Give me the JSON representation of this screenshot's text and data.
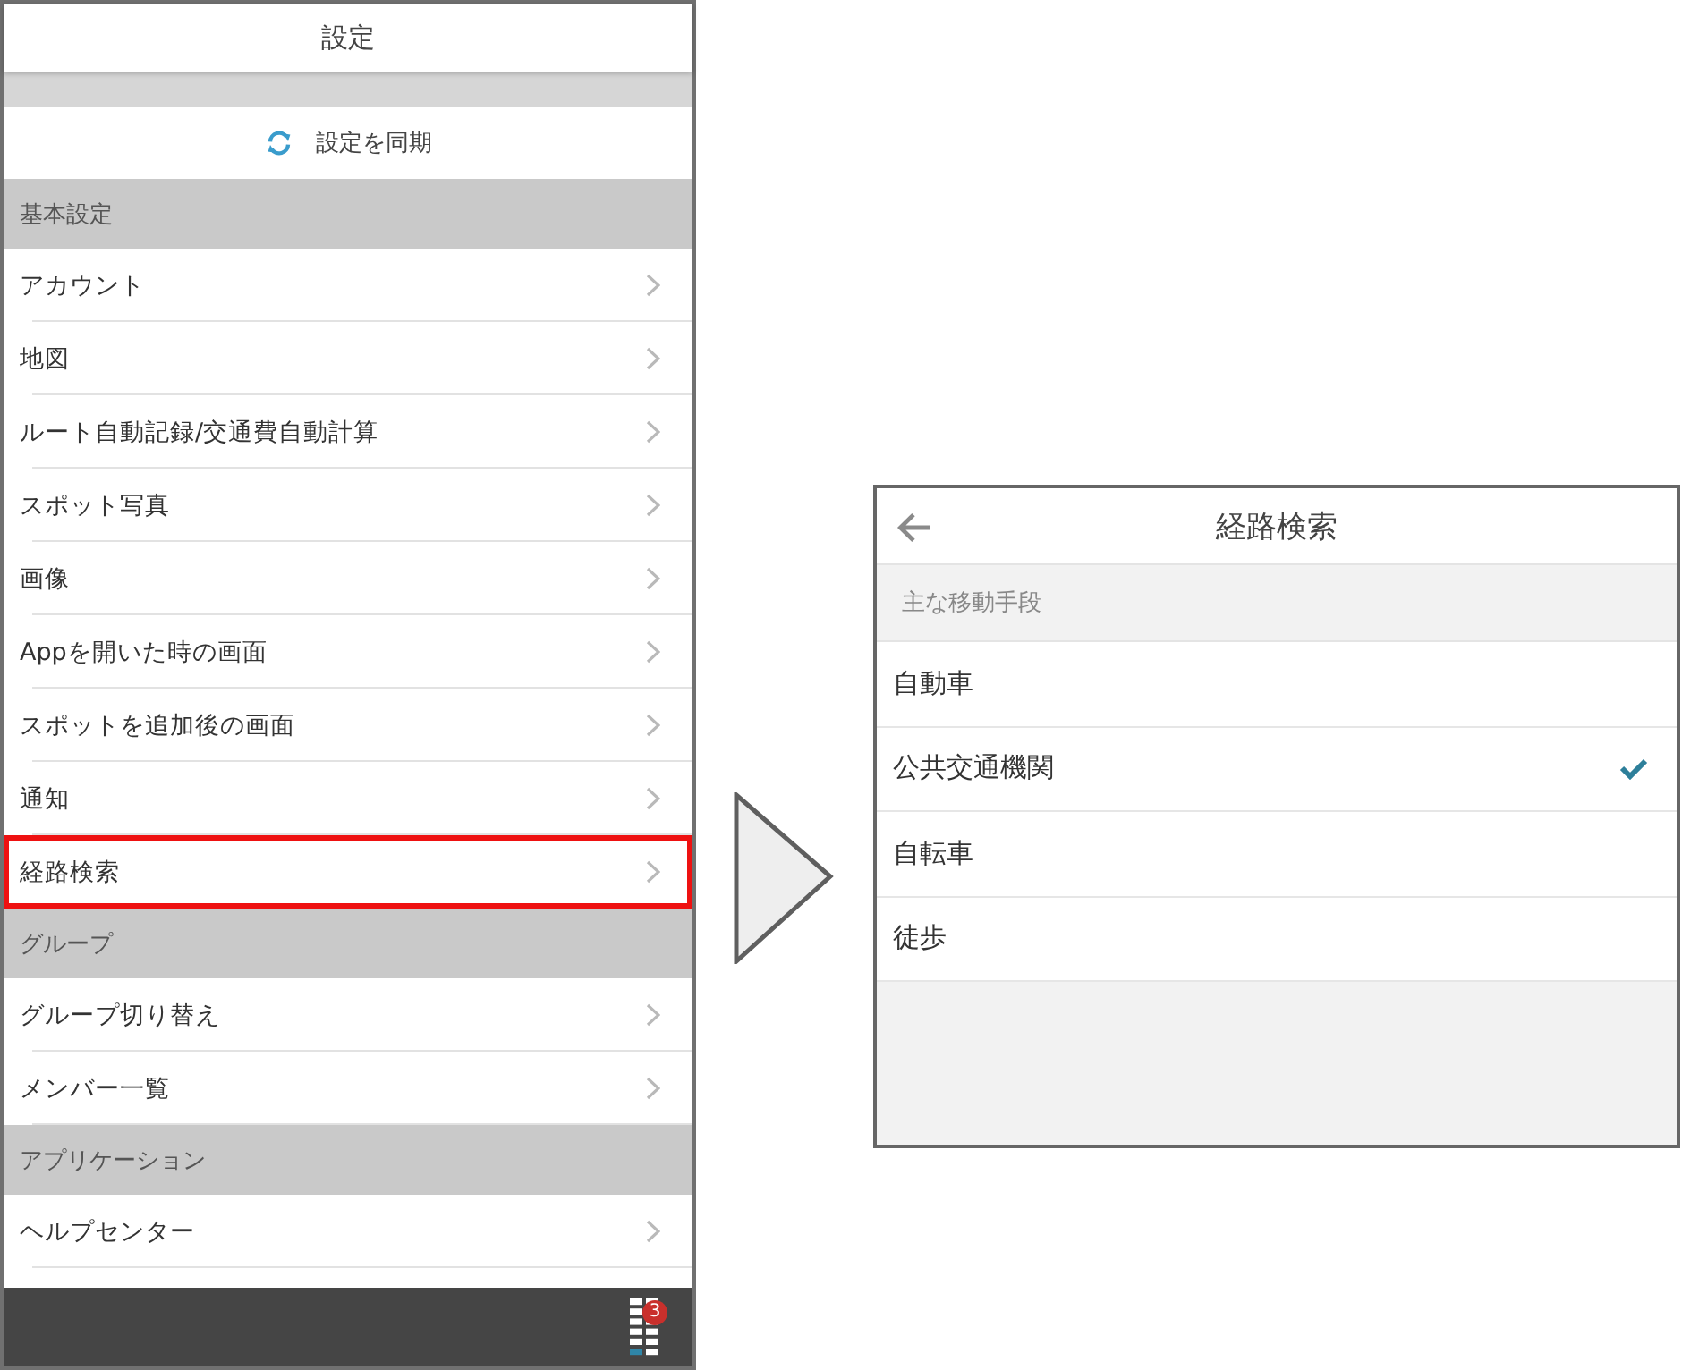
{
  "left_screen": {
    "title": "設定",
    "sync_button": "設定を同期",
    "sections": [
      {
        "header": "基本設定",
        "items": [
          {
            "label": "アカウント",
            "highlighted": false
          },
          {
            "label": "地図",
            "highlighted": false
          },
          {
            "label": "ルート自動記録/交通費自動計算",
            "highlighted": false
          },
          {
            "label": "スポット写真",
            "highlighted": false
          },
          {
            "label": "画像",
            "highlighted": false
          },
          {
            "label": "Appを開いた時の画面",
            "highlighted": false
          },
          {
            "label": "スポットを追加後の画面",
            "highlighted": false
          },
          {
            "label": "通知",
            "highlighted": false
          },
          {
            "label": "経路検索",
            "highlighted": true
          }
        ]
      },
      {
        "header": "グループ",
        "items": [
          {
            "label": "グループ切り替え",
            "highlighted": false
          },
          {
            "label": "メンバー一覧",
            "highlighted": false
          }
        ]
      },
      {
        "header": "アプリケーション",
        "items": [
          {
            "label": "ヘルプセンター",
            "highlighted": false
          }
        ]
      }
    ],
    "bottom_bar": {
      "badge": "3"
    }
  },
  "right_screen": {
    "title": "経路検索",
    "section_header": "主な移動手段",
    "options": [
      {
        "label": "自動車",
        "selected": false
      },
      {
        "label": "公共交通機関",
        "selected": true
      },
      {
        "label": "自転車",
        "selected": false
      },
      {
        "label": "徒歩",
        "selected": false
      }
    ]
  }
}
